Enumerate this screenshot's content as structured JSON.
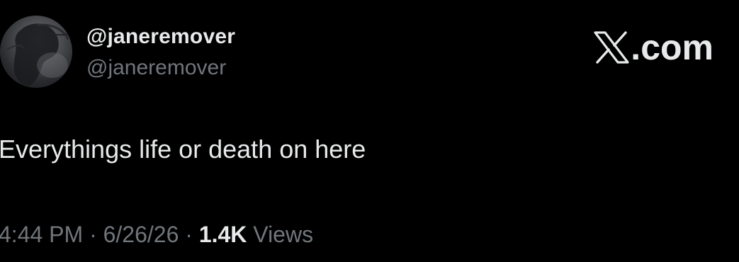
{
  "author": {
    "display_name": "@janeremover",
    "handle": "@janeremover",
    "avatar_icon": "profile-photo"
  },
  "brand": {
    "icon": "x-logo-icon",
    "text": ".com"
  },
  "tweet": {
    "text": "Everythings life or death on here"
  },
  "meta": {
    "time": "4:44 PM",
    "separator_1": " · ",
    "date": "6/26/26",
    "separator_2": " · ",
    "views_count": "1.4K",
    "views_label": " Views"
  },
  "colors": {
    "background": "#000000",
    "primary_text": "#e7e9ea",
    "secondary_text": "#71767b"
  }
}
